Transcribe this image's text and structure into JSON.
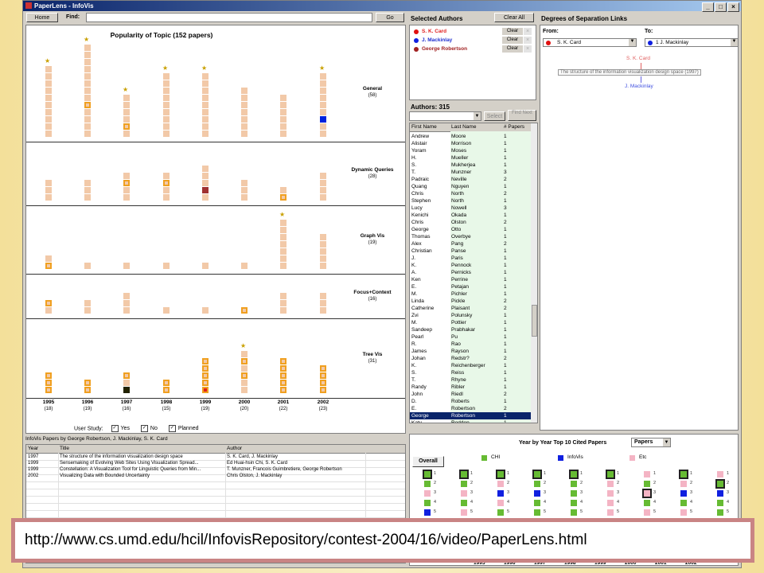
{
  "window": {
    "title": "PaperLens - InfoVis",
    "controls": [
      "_",
      "□",
      "×"
    ]
  },
  "toolbar": {
    "home_label": "Home",
    "find_label": "Find:",
    "go_label": "Go",
    "find_value": ""
  },
  "chart": {
    "title": "Popularity of Topic (152 papers)",
    "years": [
      "1995",
      "1996",
      "1997",
      "1998",
      "1999",
      "2000",
      "2001",
      "2002"
    ],
    "year_counts": [
      "(18)",
      "(19)",
      "(16)",
      "(15)",
      "(19)",
      "(20)",
      "(22)",
      "(23)"
    ],
    "topics": [
      {
        "name": "General",
        "count": "(58)",
        "values": [
          10,
          13,
          6,
          9,
          9,
          7,
          6,
          9
        ],
        "stars": [
          1,
          1,
          1,
          1,
          1,
          0,
          0,
          1
        ],
        "highlights": [
          [],
          [
            4
          ],
          [
            1
          ],
          [],
          [],
          [],
          [],
          []
        ],
        "colored": [
          {
            "col": 7,
            "idx": 2,
            "color": "#0022dd"
          }
        ]
      },
      {
        "name": "Dynamic Queries",
        "count": "(28)",
        "values": [
          3,
          3,
          4,
          4,
          5,
          3,
          2,
          4
        ],
        "stars": [
          0,
          0,
          0,
          0,
          0,
          0,
          0,
          0
        ],
        "highlights": [
          [],
          [],
          [
            2
          ],
          [
            2
          ],
          [],
          [],
          [
            0
          ],
          []
        ],
        "colored": [
          {
            "col": 4,
            "idx": 1,
            "color": "#a03030"
          }
        ]
      },
      {
        "name": "Graph Vis",
        "count": "(19)",
        "values": [
          2,
          1,
          1,
          1,
          1,
          1,
          7,
          5
        ],
        "stars": [
          0,
          0,
          0,
          0,
          0,
          0,
          1,
          0
        ],
        "highlights": [
          [
            0
          ],
          [],
          [],
          [],
          [],
          [],
          [],
          []
        ],
        "colored": []
      },
      {
        "name": "Focus+Context",
        "count": "(16)",
        "values": [
          2,
          2,
          3,
          1,
          1,
          1,
          3,
          3
        ],
        "stars": [
          0,
          0,
          0,
          0,
          0,
          0,
          0,
          0
        ],
        "highlights": [
          [
            1
          ],
          [],
          [],
          [],
          [],
          [
            0
          ],
          [],
          []
        ],
        "colored": []
      },
      {
        "name": "Tree Vis",
        "count": "(31)",
        "values": [
          3,
          2,
          3,
          2,
          5,
          6,
          5,
          4
        ],
        "stars": [
          0,
          0,
          0,
          0,
          0,
          1,
          0,
          0
        ],
        "highlights": [
          [
            0,
            1,
            2
          ],
          [
            0,
            1
          ],
          [
            2
          ],
          [
            0,
            1
          ],
          [
            0,
            1,
            2,
            3,
            4
          ],
          [
            2,
            4
          ],
          [
            0,
            1,
            2,
            3,
            4
          ],
          [
            0,
            1,
            2,
            3
          ]
        ],
        "colored": [
          {
            "col": 4,
            "idx": 0,
            "color": "#e02020"
          },
          {
            "col": 2,
            "idx": 0,
            "color": "#222200"
          }
        ]
      }
    ]
  },
  "user_study": {
    "label": "User Study:",
    "options": [
      "Yes",
      "No",
      "Planned"
    ]
  },
  "selected_authors": {
    "title": "Selected Authors",
    "clear_all": "Clear All",
    "items": [
      {
        "name": "S. K. Card",
        "color": "#e01010",
        "text_color": "#e02020",
        "clear": "Clear"
      },
      {
        "name": "J. Mackinlay",
        "color": "#1020e0",
        "text_color": "#2030d0",
        "clear": "Clear"
      },
      {
        "name": "George Robertson",
        "color": "#a02020",
        "text_color": "#a02020",
        "clear": "Clear"
      }
    ]
  },
  "degrees": {
    "title": "Degrees of Separation Links",
    "from_label": "From:",
    "to_label": "To:",
    "from_value": "S. K. Card",
    "to_value": "1   J. Mackinlay",
    "from_color": "#e01010",
    "to_color": "#1020e0",
    "path_from": "S. K. Card",
    "path_paper": "The structure of the information visualization design space (1997)",
    "path_to": "J. Mackinlay"
  },
  "authors": {
    "header": "Authors: 315",
    "select_label": "Select",
    "find_next_label": "Find Next",
    "columns": [
      "First Name",
      "Last Name",
      "# Papers"
    ],
    "rows": [
      [
        "Andrew",
        "Moore",
        "1"
      ],
      [
        "Alistair",
        "Morrison",
        "1"
      ],
      [
        "Yoram",
        "Moses",
        "1"
      ],
      [
        "H.",
        "Mueller",
        "1"
      ],
      [
        "S.",
        "Mukherjea",
        "1"
      ],
      [
        "T.",
        "Munzner",
        "3"
      ],
      [
        "Padraic",
        "Neville",
        "2"
      ],
      [
        "Quang",
        "Nguyen",
        "1"
      ],
      [
        "Chris",
        "North",
        "2"
      ],
      [
        "Stephen",
        "North",
        "1"
      ],
      [
        "Lucy",
        "Nowell",
        "3"
      ],
      [
        "Kenichi",
        "Okada",
        "1"
      ],
      [
        "Chris",
        "Olston",
        "2"
      ],
      [
        "George",
        "Otto",
        "1"
      ],
      [
        "Thomas",
        "Overbye",
        "1"
      ],
      [
        "Alex",
        "Pang",
        "2"
      ],
      [
        "Christian",
        "Panse",
        "1"
      ],
      [
        "J.",
        "Paris",
        "1"
      ],
      [
        "K.",
        "Pennock",
        "1"
      ],
      [
        "A.",
        "Pernicks",
        "1"
      ],
      [
        "Ken",
        "Perrine",
        "1"
      ],
      [
        "E.",
        "Petajan",
        "1"
      ],
      [
        "M.",
        "Pichler",
        "1"
      ],
      [
        "Linda",
        "Pickle",
        "2"
      ],
      [
        "Catherine",
        "Plaisant",
        "2"
      ],
      [
        "Zvi",
        "Polunsky",
        "1"
      ],
      [
        "M.",
        "Pottier",
        "1"
      ],
      [
        "Sandeep",
        "Prabhakar",
        "1"
      ],
      [
        "Pearl",
        "Pu",
        "1"
      ],
      [
        "R.",
        "Rao",
        "1"
      ],
      [
        "James",
        "Rayson",
        "1"
      ],
      [
        "Johan",
        "Redstr?",
        "2"
      ],
      [
        "K.",
        "Reichenberger",
        "1"
      ],
      [
        "S.",
        "Reiss",
        "1"
      ],
      [
        "T.",
        "Rhyne",
        "1"
      ],
      [
        "Randy",
        "Ribler",
        "1"
      ],
      [
        "John",
        "Riedl",
        "2"
      ],
      [
        "D.",
        "Roberts",
        "1"
      ],
      [
        "E.",
        "Robertson",
        "2"
      ],
      [
        "George",
        "Robertson",
        "1"
      ],
      [
        "Katy",
        "Rodden",
        "1"
      ]
    ],
    "selected_index": 39
  },
  "papers": {
    "header": "InfoVis Papers by George Robertson, J. Mackinlay, S. K. Card",
    "columns": [
      "Year",
      "Title",
      "Author"
    ],
    "rows": [
      [
        "1997",
        "The structure of the information visualization design space",
        "S. K. Card, J. Mackinlay"
      ],
      [
        "1999",
        "Sensemaking of Evolving Web Sites Using Visualization Spread...",
        "Ed Huai-hsin Chi, S. K. Card"
      ],
      [
        "1999",
        "Constellation: A Visualization Tool for Linguistic Queries from Min...",
        "T. Munzner, Francois Guimbretiere, George Robertson"
      ],
      [
        "2002",
        "Visualizing Data with Bounded Uncertainty",
        "Chris Olston, J. Mackinlay"
      ]
    ]
  },
  "cited": {
    "title": "Year by Year Top 10 Cited Papers",
    "dropdown_value": "Papers",
    "overall_tab": "Overall",
    "legend": [
      {
        "label": "CHI",
        "color": "#66bb33"
      },
      {
        "label": "InfoVis",
        "color": "#1020e0"
      },
      {
        "label": "Etc",
        "color": "#f4b4c4"
      }
    ],
    "columns": [
      {
        "cells": [
          [
            "g",
            1
          ],
          [
            "g",
            2
          ],
          [
            "p",
            3
          ],
          [
            "g",
            4
          ],
          [
            "b",
            5
          ],
          [
            "g",
            6
          ]
        ],
        "boxed": [
          0
        ]
      },
      {
        "cells": [
          [
            "g",
            1
          ],
          [
            "g",
            2
          ],
          [
            "p",
            3
          ],
          [
            "g",
            4
          ],
          [
            "p",
            5
          ],
          [
            "g",
            6
          ]
        ],
        "boxed": [
          0
        ]
      },
      {
        "cells": [
          [
            "g",
            1
          ],
          [
            "p",
            2
          ],
          [
            "b",
            3
          ],
          [
            "p",
            4
          ],
          [
            "g",
            5
          ],
          [
            "p",
            6
          ]
        ],
        "boxed": [
          0
        ]
      },
      {
        "cells": [
          [
            "g",
            1
          ],
          [
            "g",
            2
          ],
          [
            "b",
            3
          ],
          [
            "g",
            4
          ],
          [
            "g",
            5
          ],
          [
            "p",
            6
          ]
        ],
        "boxed": [
          0
        ]
      },
      {
        "cells": [
          [
            "g",
            1
          ],
          [
            "g",
            2
          ],
          [
            "g",
            3
          ],
          [
            "g",
            4
          ],
          [
            "g",
            5
          ],
          [
            "p",
            6
          ]
        ],
        "boxed": [
          0
        ]
      },
      {
        "cells": [
          [
            "g",
            1
          ],
          [
            "p",
            2
          ],
          [
            "p",
            3
          ],
          [
            "p",
            4
          ],
          [
            "p",
            5
          ],
          [
            "g",
            6
          ]
        ],
        "boxed": [
          0
        ]
      },
      {
        "cells": [
          [
            "p",
            1
          ],
          [
            "g",
            2
          ],
          [
            "p",
            3
          ],
          [
            "g",
            4
          ],
          [
            "p",
            5
          ],
          [
            "g",
            6
          ]
        ],
        "boxed": [
          2
        ]
      },
      {
        "cells": [
          [
            "g",
            1
          ],
          [
            "p",
            2
          ],
          [
            "b",
            3
          ],
          [
            "g",
            4
          ],
          [
            "p",
            5
          ],
          [
            "g",
            6
          ]
        ],
        "boxed": [
          0
        ]
      },
      {
        "cells": [
          [
            "p",
            1
          ],
          [
            "g",
            2
          ],
          [
            "b",
            3
          ],
          [
            "g",
            4
          ],
          [
            "g",
            5
          ],
          [
            "p",
            6
          ]
        ],
        "boxed": [
          1
        ]
      }
    ],
    "bottom_years": [
      "1995",
      "1996",
      "1997",
      "1998",
      "1999",
      "2000",
      "2001",
      "2002"
    ]
  },
  "banner": {
    "url": "http://www.cs.umd.edu/hcil/InfovisRepository/contest-2004/16/video/PaperLens.html"
  }
}
